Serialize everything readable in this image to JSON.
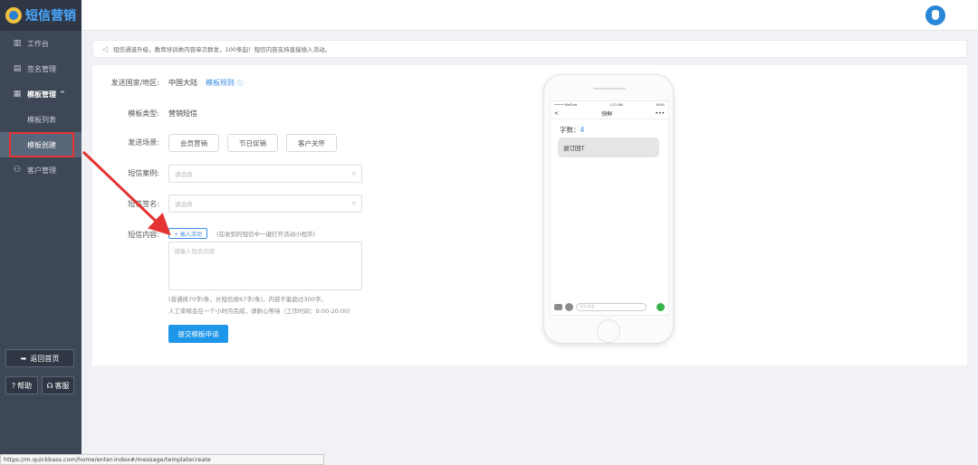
{
  "sidebar": {
    "brand": "短信营销",
    "items": [
      {
        "label": "工作台",
        "icon": "bar-chart-icon"
      },
      {
        "label": "签名管理",
        "icon": "signature-icon"
      },
      {
        "label": "模板管理",
        "icon": "template-icon"
      }
    ],
    "submenu": [
      {
        "label": "模板列表"
      },
      {
        "label": "模板创建"
      }
    ],
    "customer": "客户管理",
    "back_home": "返回首页",
    "help": "帮助",
    "service": "客服"
  },
  "notice": "短信通道升级，教育培训类内容单次群发，100条起！短信内容支持直接插入活动。",
  "form": {
    "country_label": "发送国家/地区:",
    "country_value": "中国大陆",
    "country_link": "模板规则",
    "type_label": "模板类型:",
    "type_value": "营销短信",
    "scene_label": "发送场景:",
    "scenes": [
      "会员营销",
      "节日促销",
      "客户关怀"
    ],
    "case_label": "短信案例:",
    "case_placeholder": "请选择",
    "sign_label": "短信签名:",
    "sign_placeholder": "请选择",
    "content_label": "短信内容:",
    "insert_label": "+ 插入活动",
    "insert_hint": "(在收到的短信中一键打开活动小程序)",
    "content_placeholder": "请输入短信内容",
    "rule_hint_1": "(普通按70字/条，长短信按67字/条)，内容不能超过300字。",
    "rule_hint_2": "人工审核会在一个小时内完成，请耐心等待（工作时间：9:00-20:00）",
    "submit": "提交模板申请"
  },
  "phone": {
    "carrier": "••••• WeChat",
    "time": "1:21 AM",
    "battery": "100%",
    "back": "<",
    "title": "快鲜",
    "more": "•••",
    "wordcount_label": "字数：",
    "wordcount": "4",
    "bubble": "退订回T",
    "input_placeholder": "短信/彩信"
  },
  "status_url": "https://m.quickbass.com/home/enter-index#/message/templatecreate",
  "colors": {
    "sidebar": "#3e4756",
    "accent": "#1e96ea",
    "highlight": "#e53333"
  }
}
